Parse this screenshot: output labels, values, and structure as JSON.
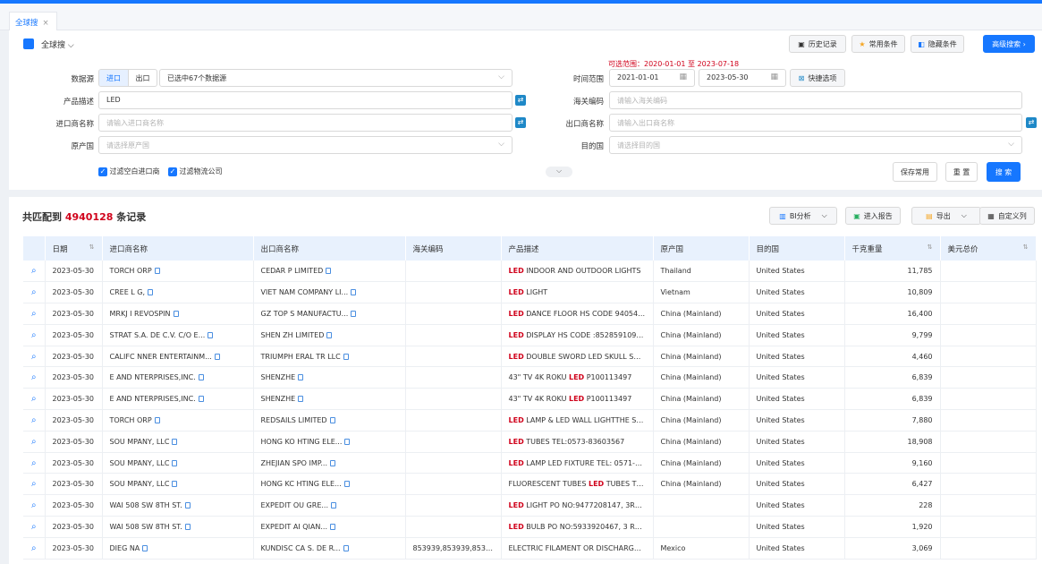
{
  "tab": {
    "label": "全球搜",
    "close": "×"
  },
  "header": {
    "mode_label": "全球搜",
    "history": "历史记录",
    "favorites": "常用条件",
    "hide": "隐藏条件",
    "advanced": "高级搜索 ›"
  },
  "range_note": "可选范围：2020-01-01 至 2023-07-18",
  "form": {
    "source_label": "数据源",
    "import_tab": "进口",
    "export_tab": "出口",
    "source_value": "已选中67个数据源",
    "time_label": "时间范围",
    "date_from": "2021-01-01",
    "date_to": "2023-05-30",
    "quick": "快捷选项",
    "product_label": "产品描述",
    "product_value": "LED",
    "hscode_label": "海关编码",
    "hscode_ph": "请输入海关编码",
    "importer_label": "进口商名称",
    "importer_ph": "请输入进口商名称",
    "exporter_label": "出口商名称",
    "exporter_ph": "请输入出口商名称",
    "origin_label": "原产国",
    "origin_ph": "请选择原产国",
    "dest_label": "目的国",
    "dest_ph": "请选择目的国",
    "filter1": "过滤空白进口商",
    "filter2": "过滤物流公司",
    "save": "保存常用",
    "reset": "重 置",
    "search": "搜 索"
  },
  "results": {
    "prefix": "共匹配到",
    "count": "4940128",
    "suffix": "条记录",
    "analysis": "BI分析",
    "report": "进入报告",
    "export": "导出",
    "custom": "自定义列"
  },
  "columns": [
    "日期",
    "进口商名称",
    "出口商名称",
    "海关编码",
    "产品描述",
    "原产国",
    "目的国",
    "千克重量",
    "美元总价"
  ],
  "colors": {
    "accent": "#1677ff",
    "highlight": "#d0021b",
    "header_bg": "#e8f1fd"
  },
  "rows": [
    {
      "date": "2023-05-30",
      "importer": "TORCH ORP",
      "exporter": "CEDAR P LIMITED",
      "hs": "",
      "desc_pre": "",
      "desc_hl": "LED",
      "desc_post": " INDOOR AND OUTDOOR LIGHTS",
      "origin": "Thailand",
      "dest": "United States",
      "kg": "11,785",
      "usd": ""
    },
    {
      "date": "2023-05-30",
      "importer": "CREE L G,",
      "exporter": "VIET NAM COMPANY LI...",
      "hs": "",
      "desc_pre": "",
      "desc_hl": "LED",
      "desc_post": " LIGHT",
      "origin": "Vietnam",
      "dest": "United States",
      "kg": "10,809",
      "usd": ""
    },
    {
      "date": "2023-05-30",
      "importer": "MRKJ I REVOSPIN",
      "exporter": "GZ TOP S MANUFACTU...",
      "hs": "",
      "desc_pre": "",
      "desc_hl": "LED",
      "desc_post": " DANCE FLOOR HS CODE 9405429...",
      "origin": "China (Mainland)",
      "dest": "United States",
      "kg": "16,400",
      "usd": ""
    },
    {
      "date": "2023-05-30",
      "importer": "STRAT S.A. DE C.V. C/O E...",
      "exporter": "SHEN ZH LIMITED",
      "hs": "",
      "desc_pre": "",
      "desc_hl": "LED",
      "desc_post": " DISPLAY HS CODE :8528591090 ...",
      "origin": "China (Mainland)",
      "dest": "United States",
      "kg": "9,799",
      "usd": ""
    },
    {
      "date": "2023-05-30",
      "importer": "CALIFC NNER ENTERTAINM...",
      "exporter": "TRIUMPH ERAL TR LLC",
      "hs": "",
      "desc_pre": "",
      "desc_hl": "LED",
      "desc_post": " DOUBLE SWORD LED SKULL SW...",
      "origin": "China (Mainland)",
      "dest": "United States",
      "kg": "4,460",
      "usd": ""
    },
    {
      "date": "2023-05-30",
      "importer": "E AND NTERPRISES,INC.",
      "exporter": "SHENZHE",
      "hs": "",
      "desc_pre": "43\" TV 4K ROKU ",
      "desc_hl": "LED",
      "desc_post": " P100113497",
      "origin": "China (Mainland)",
      "dest": "United States",
      "kg": "6,839",
      "usd": ""
    },
    {
      "date": "2023-05-30",
      "importer": "E AND NTERPRISES,INC.",
      "exporter": "SHENZHE",
      "hs": "",
      "desc_pre": "43\" TV 4K ROKU ",
      "desc_hl": "LED",
      "desc_post": " P100113497",
      "origin": "China (Mainland)",
      "dest": "United States",
      "kg": "6,839",
      "usd": ""
    },
    {
      "date": "2023-05-30",
      "importer": "TORCH ORP",
      "exporter": "REDSAILS LIMITED",
      "hs": "",
      "desc_pre": "",
      "desc_hl": "LED",
      "desc_post": " LAMP & LED WALL LIGHTTHE SH...",
      "origin": "China (Mainland)",
      "dest": "United States",
      "kg": "7,880",
      "usd": ""
    },
    {
      "date": "2023-05-30",
      "importer": "SOU MPANY, LLC",
      "exporter": "HONG KO HTING ELE...",
      "hs": "",
      "desc_pre": "",
      "desc_hl": "LED",
      "desc_post": " TUBES TEL:0573-83603567",
      "origin": "China (Mainland)",
      "dest": "United States",
      "kg": "18,908",
      "usd": ""
    },
    {
      "date": "2023-05-30",
      "importer": "SOU MPANY, LLC",
      "exporter": "ZHEJIAN SPO IMP...",
      "hs": "",
      "desc_pre": "",
      "desc_hl": "LED",
      "desc_post": " LAMP LED FIXTURE TEL: 0571-87...",
      "origin": "China (Mainland)",
      "dest": "United States",
      "kg": "9,160",
      "usd": ""
    },
    {
      "date": "2023-05-30",
      "importer": "SOU MPANY, LLC",
      "exporter": "HONG KC HTING ELE...",
      "hs": "",
      "desc_pre": "FLUORESCENT TUBES ",
      "desc_hl": "LED",
      "desc_post": " TUBES TEL...",
      "origin": "China (Mainland)",
      "dest": "United States",
      "kg": "6,427",
      "usd": ""
    },
    {
      "date": "2023-05-30",
      "importer": "WAI 508 SW 8TH ST.",
      "exporter": "EXPEDIT OU GRE...",
      "hs": "",
      "desc_pre": "",
      "desc_hl": "LED",
      "desc_post": " LIGHT PO NO:9477208147, 3RD ...",
      "origin": "",
      "dest": "United States",
      "kg": "228",
      "usd": ""
    },
    {
      "date": "2023-05-30",
      "importer": "WAI 508 SW 8TH ST.",
      "exporter": "EXPEDIT AI QIAN...",
      "hs": "",
      "desc_pre": "",
      "desc_hl": "LED",
      "desc_post": " BULB PO NO:5933920467, 3 RD N...",
      "origin": "",
      "dest": "United States",
      "kg": "1,920",
      "usd": ""
    },
    {
      "date": "2023-05-30",
      "importer": "DIEG NA",
      "exporter": "KUNDISC CA S. DE R...",
      "hs": "853939,853939,853939",
      "desc_pre": "ELECTRIC FILAMENT OR DISCHARGE L...",
      "desc_hl": "",
      "desc_post": "",
      "origin": "Mexico",
      "dest": "United States",
      "kg": "3,069",
      "usd": ""
    }
  ]
}
